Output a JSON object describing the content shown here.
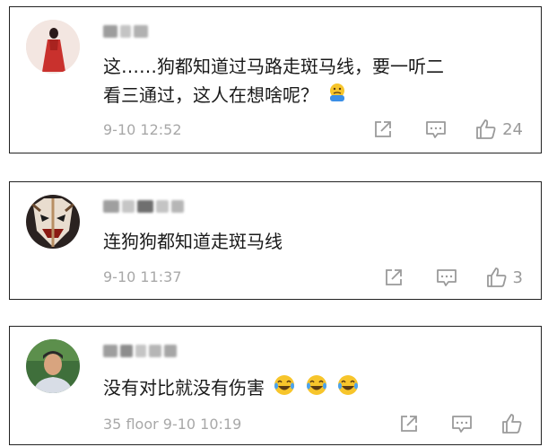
{
  "comments": [
    {
      "text": "这……狗都知道过马路走斑马线，要一听二",
      "text2": "看三通过，这人在想啥呢？",
      "emoji": "thinking-face-icon",
      "meta": "9-10 12:52",
      "likes": "24"
    },
    {
      "text": "连狗狗都知道走斑马线",
      "meta": "9-10 11:37",
      "likes": "3"
    },
    {
      "text": "没有对比就没有伤害",
      "emoji": "laughing-crying-face-icon",
      "emoji_count": 3,
      "meta": "35 floor 9-10 10:19",
      "likes": ""
    }
  ],
  "colors": {
    "text": "#1a1a1a",
    "meta": "#a8a8a8",
    "icon": "#9a9a9a",
    "border": "#222222",
    "emoji_yellow": "#f7c52b"
  }
}
